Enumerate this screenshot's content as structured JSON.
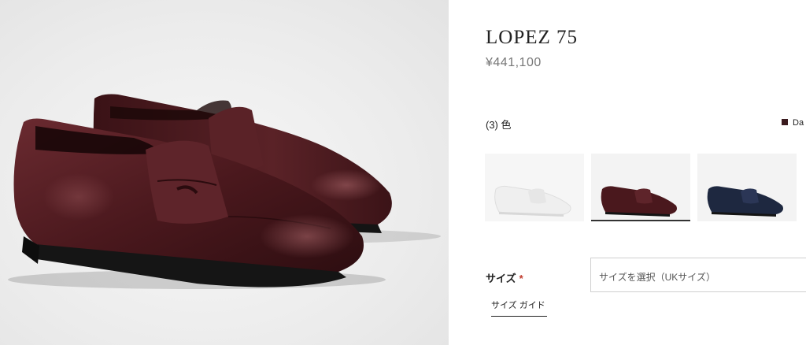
{
  "product": {
    "name": "LOPEZ 75",
    "price": "¥441,100"
  },
  "colors": {
    "count_label": "(3) 色",
    "current_label": "Da",
    "current_color": "#3a1a1e",
    "swatches": [
      {
        "name": "white",
        "color": "#f4f4f4"
      },
      {
        "name": "dark-brown",
        "color": "#3d1a1e",
        "selected": true
      },
      {
        "name": "navy",
        "color": "#1e2840"
      }
    ]
  },
  "size": {
    "label": "サイズ",
    "required_mark": "*",
    "placeholder": "サイズを選択（UKサイズ）",
    "guide_link": "サイズ ガイド"
  },
  "accent": {
    "required": "#c0392b"
  }
}
